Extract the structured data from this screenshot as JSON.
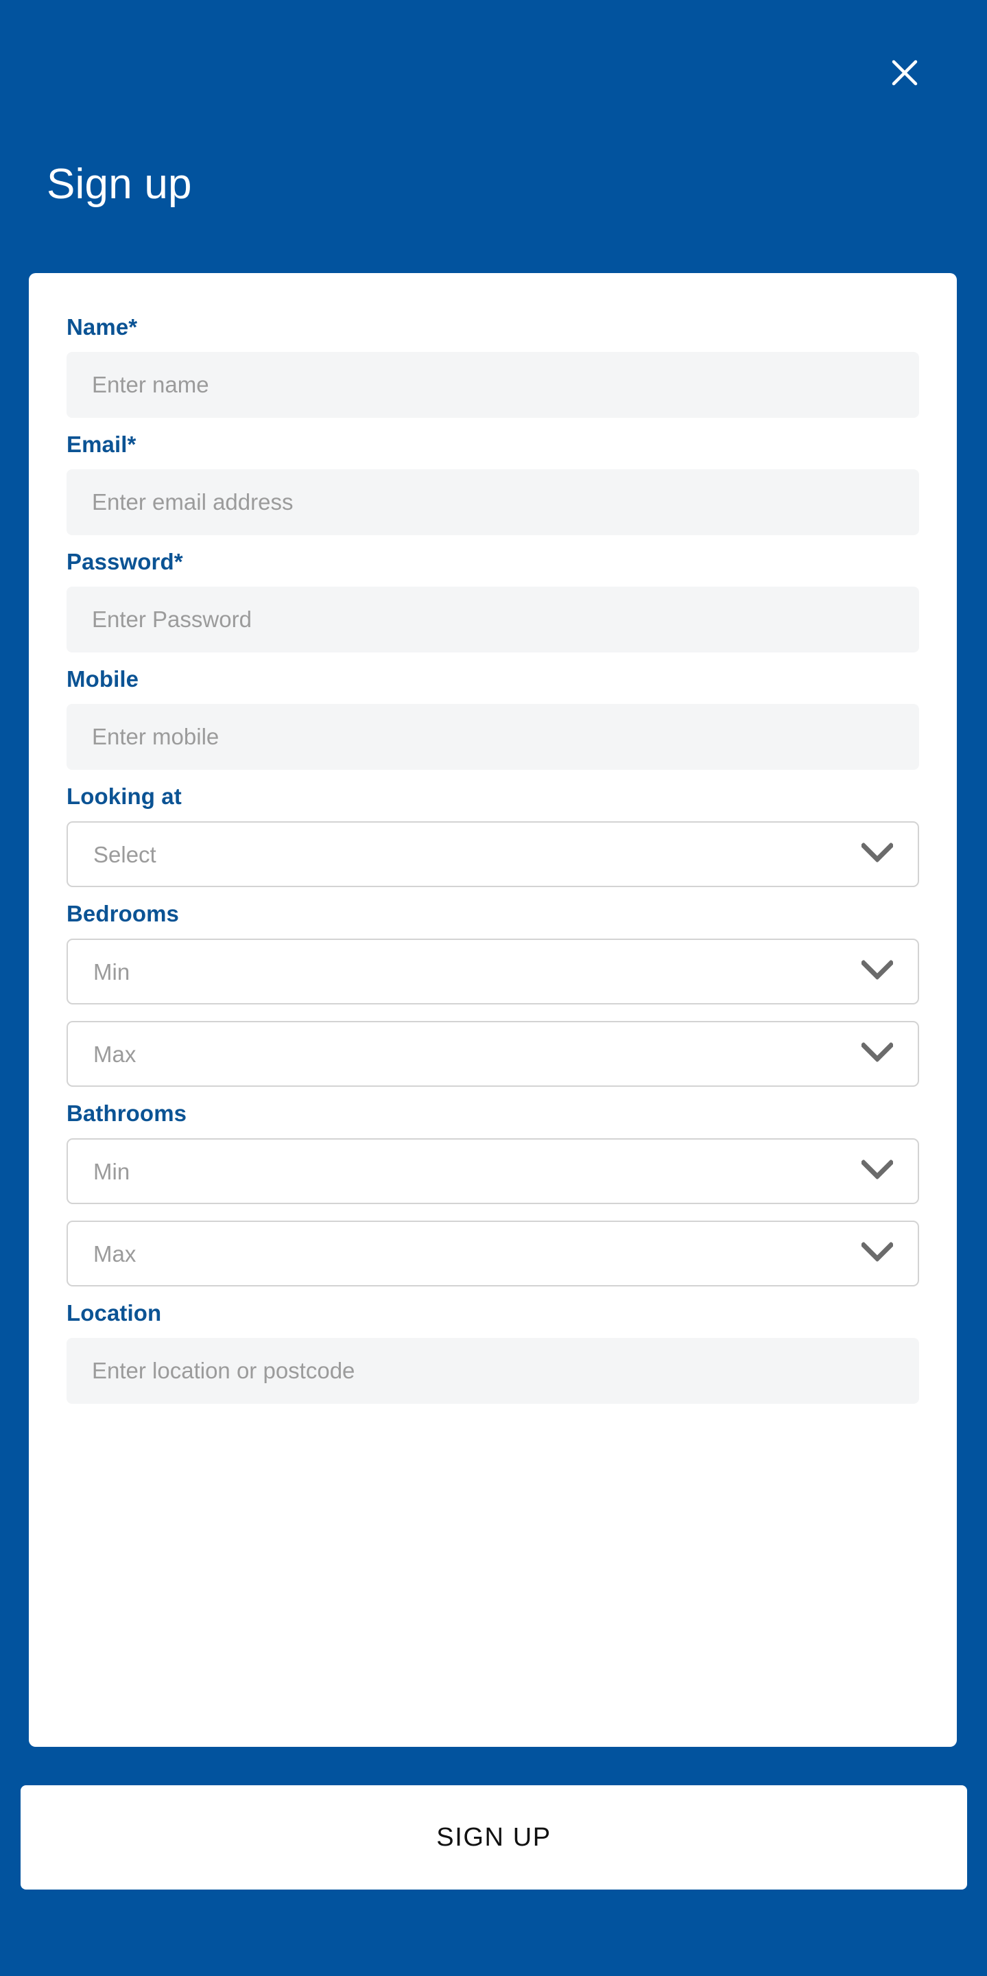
{
  "theme": {
    "background_blue": "#02539E",
    "label_blue": "#0B5394",
    "card_white": "#FFFFFF",
    "input_fill": "#F4F5F6",
    "placeholder_gray": "#9B9B9B",
    "border_gray": "#D3D3D3",
    "button_text": "#111111"
  },
  "header": {
    "title": "Sign up",
    "close_icon": "close-icon"
  },
  "form": {
    "fields": [
      {
        "key": "name",
        "label": "Name*",
        "type": "text",
        "placeholder": "Enter name",
        "value": ""
      },
      {
        "key": "email",
        "label": "Email*",
        "type": "text",
        "placeholder": "Enter email address",
        "value": ""
      },
      {
        "key": "password",
        "label": "Password*",
        "type": "password",
        "placeholder": "Enter Password",
        "value": ""
      },
      {
        "key": "mobile",
        "label": "Mobile",
        "type": "text",
        "placeholder": "Enter mobile",
        "value": ""
      },
      {
        "key": "looking_at",
        "label": "Looking at",
        "type": "select",
        "placeholder": "Select",
        "value": ""
      },
      {
        "key": "bedrooms",
        "label": "Bedrooms",
        "type": "select-range",
        "min_placeholder": "Min",
        "max_placeholder": "Max",
        "min_value": "",
        "max_value": ""
      },
      {
        "key": "bathrooms",
        "label": "Bathrooms",
        "type": "select-range",
        "min_placeholder": "Min",
        "max_placeholder": "Max",
        "min_value": "",
        "max_value": ""
      },
      {
        "key": "location",
        "label": "Location",
        "type": "text",
        "placeholder": "Enter location or postcode",
        "value": ""
      }
    ],
    "labels": {
      "name": "Name*",
      "email": "Email*",
      "password": "Password*",
      "mobile": "Mobile",
      "looking_at": "Looking at",
      "bedrooms": "Bedrooms",
      "bathrooms": "Bathrooms",
      "location": "Location"
    },
    "placeholders": {
      "name": "Enter name",
      "email": "Enter email address",
      "password": "Enter Password",
      "mobile": "Enter mobile",
      "looking_at": "Select",
      "bedrooms_min": "Min",
      "bedrooms_max": "Max",
      "bathrooms_min": "Min",
      "bathrooms_max": "Max",
      "location": "Enter location or postcode"
    },
    "icons": {
      "dropdown": "chevron-down-icon"
    }
  },
  "footer": {
    "submit_label": "SIGN UP"
  }
}
